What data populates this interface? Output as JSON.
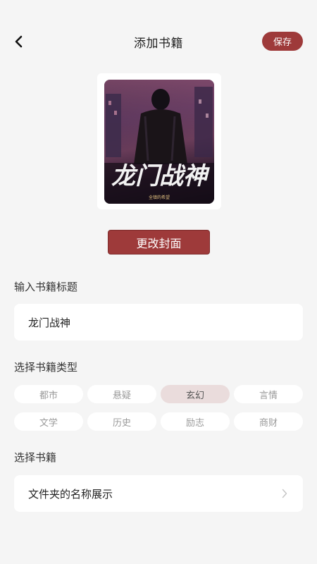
{
  "header": {
    "title": "添加书籍",
    "save_label": "保存"
  },
  "cover": {
    "title_text": "龙门战神",
    "author_text": "全镇的希望"
  },
  "change_cover_label": "更改封面",
  "title_section": {
    "label": "输入书籍标题",
    "value": "龙门战神"
  },
  "type_section": {
    "label": "选择书籍类型",
    "options": [
      "都市",
      "悬疑",
      "玄幻",
      "言情",
      "文学",
      "历史",
      "励志",
      "商财"
    ],
    "selected": "玄幻"
  },
  "book_section": {
    "label": "选择书籍",
    "value": "文件夹的名称展示"
  },
  "colors": {
    "accent": "#9e3a3a",
    "background": "#f5f5f5",
    "chip_selected": "#eadcdc"
  }
}
